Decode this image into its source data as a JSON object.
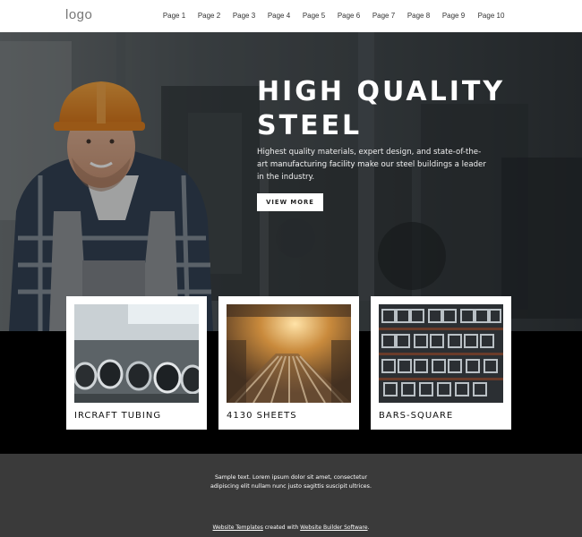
{
  "header": {
    "logo": "logo",
    "nav": [
      "Page 1",
      "Page 2",
      "Page 3",
      "Page 4",
      "Page 5",
      "Page 6",
      "Page 7",
      "Page 8",
      "Page 9",
      "Page 10"
    ]
  },
  "hero": {
    "title_line1": "HIGH QUALITY",
    "title_line2": "STEEL",
    "text": "Highest quality materials, expert design, and state-of-the-art manufacturing facility make our steel buildings a leader in the industry.",
    "button_label": "VIEW MORE"
  },
  "cards": [
    {
      "label": "IRCRAFT TUBING"
    },
    {
      "label": "4130 SHEETS"
    },
    {
      "label": "BARS-SQUARE"
    }
  ],
  "footer": {
    "text_line1": "Sample text. Lorem ipsum dolor sit amet, consectetur",
    "text_line2": "adipiscing elit nullam nunc justo sagittis suscipit ultrices.",
    "credit_link1": "Website Templates",
    "credit_mid": " created with ",
    "credit_link2": "Website Builder Software",
    "credit_end": "."
  },
  "colors": {
    "header_bg": "#ffffff",
    "band": "#000000",
    "footer_bg": "#3a3a3a",
    "helmet": "#f08a1c"
  }
}
